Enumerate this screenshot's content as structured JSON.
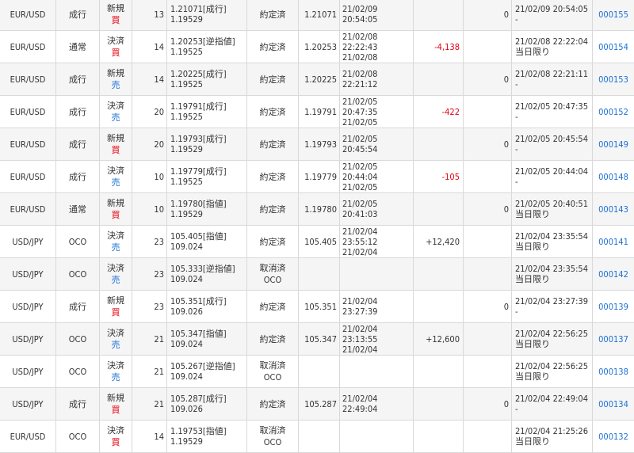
{
  "colors": {
    "buy": "#e60012",
    "sell": "#1a6fd6",
    "negative": "#e60012",
    "link": "#1a6fd6",
    "grid": "#d9d9d9"
  },
  "rows": [
    {
      "pair": "EUR/USD",
      "kind": "成行",
      "trade": "新規",
      "side": "買",
      "side_type": "buy",
      "qty": "13",
      "price1": "1.21071[成行]",
      "price2": "1.19529",
      "status1": "約定済",
      "status2": "",
      "exec": "1.21071",
      "date1": "21/02/09 20:54:05",
      "date2": "",
      "pl": "",
      "pl_type": "",
      "swap": "0",
      "odate1": "21/02/09 20:54:05",
      "odate2": "-",
      "id": "000155"
    },
    {
      "pair": "EUR/USD",
      "kind": "通常",
      "trade": "決済",
      "side": "買",
      "side_type": "buy",
      "qty": "14",
      "price1": "1.20253[逆指値]",
      "price2": "1.19525",
      "status1": "約定済",
      "status2": "",
      "exec": "1.20253",
      "date1": "21/02/08 22:22:43",
      "date2": "21/02/08",
      "pl": "-4,138",
      "pl_type": "neg",
      "swap": "",
      "odate1": "21/02/08 22:22:04",
      "odate2": "当日限り",
      "id": "000154"
    },
    {
      "pair": "EUR/USD",
      "kind": "成行",
      "trade": "新規",
      "side": "売",
      "side_type": "sell",
      "qty": "14",
      "price1": "1.20225[成行]",
      "price2": "1.19525",
      "status1": "約定済",
      "status2": "",
      "exec": "1.20225",
      "date1": "21/02/08 22:21:12",
      "date2": "",
      "pl": "",
      "pl_type": "",
      "swap": "0",
      "odate1": "21/02/08 22:21:11",
      "odate2": "-",
      "id": "000153"
    },
    {
      "pair": "EUR/USD",
      "kind": "成行",
      "trade": "決済",
      "side": "売",
      "side_type": "sell",
      "qty": "20",
      "price1": "1.19791[成行]",
      "price2": "1.19525",
      "status1": "約定済",
      "status2": "",
      "exec": "1.19791",
      "date1": "21/02/05 20:47:35",
      "date2": "21/02/05",
      "pl": "-422",
      "pl_type": "neg",
      "swap": "",
      "odate1": "21/02/05 20:47:35",
      "odate2": "-",
      "id": "000152"
    },
    {
      "pair": "EUR/USD",
      "kind": "成行",
      "trade": "新規",
      "side": "買",
      "side_type": "buy",
      "qty": "20",
      "price1": "1.19793[成行]",
      "price2": "1.19529",
      "status1": "約定済",
      "status2": "",
      "exec": "1.19793",
      "date1": "21/02/05 20:45:54",
      "date2": "",
      "pl": "",
      "pl_type": "",
      "swap": "0",
      "odate1": "21/02/05 20:45:54",
      "odate2": "-",
      "id": "000149"
    },
    {
      "pair": "EUR/USD",
      "kind": "成行",
      "trade": "決済",
      "side": "売",
      "side_type": "sell",
      "qty": "10",
      "price1": "1.19779[成行]",
      "price2": "1.19525",
      "status1": "約定済",
      "status2": "",
      "exec": "1.19779",
      "date1": "21/02/05 20:44:04",
      "date2": "21/02/05",
      "pl": "-105",
      "pl_type": "neg",
      "swap": "",
      "odate1": "21/02/05 20:44:04",
      "odate2": "-",
      "id": "000148"
    },
    {
      "pair": "EUR/USD",
      "kind": "通常",
      "trade": "新規",
      "side": "買",
      "side_type": "buy",
      "qty": "10",
      "price1": "1.19780[指値]",
      "price2": "1.19529",
      "status1": "約定済",
      "status2": "",
      "exec": "1.19780",
      "date1": "21/02/05 20:41:03",
      "date2": "",
      "pl": "",
      "pl_type": "",
      "swap": "0",
      "odate1": "21/02/05 20:40:51",
      "odate2": "当日限り",
      "id": "000143"
    },
    {
      "pair": "USD/JPY",
      "kind": "OCO",
      "trade": "決済",
      "side": "売",
      "side_type": "sell",
      "qty": "23",
      "price1": "105.405[指値]",
      "price2": "109.024",
      "status1": "約定済",
      "status2": "",
      "exec": "105.405",
      "date1": "21/02/04 23:55:12",
      "date2": "21/02/04",
      "pl": "+12,420",
      "pl_type": "pos",
      "swap": "",
      "odate1": "21/02/04 23:35:54",
      "odate2": "当日限り",
      "id": "000141"
    },
    {
      "pair": "USD/JPY",
      "kind": "OCO",
      "trade": "決済",
      "side": "売",
      "side_type": "sell",
      "qty": "23",
      "price1": "105.333[逆指値]",
      "price2": "109.024",
      "status1": "取消済",
      "status2": "OCO",
      "exec": "",
      "date1": "",
      "date2": "",
      "pl": "",
      "pl_type": "",
      "swap": "",
      "odate1": "21/02/04 23:35:54",
      "odate2": "当日限り",
      "id": "000142"
    },
    {
      "pair": "USD/JPY",
      "kind": "成行",
      "trade": "新規",
      "side": "買",
      "side_type": "buy",
      "qty": "23",
      "price1": "105.351[成行]",
      "price2": "109.026",
      "status1": "約定済",
      "status2": "",
      "exec": "105.351",
      "date1": "21/02/04 23:27:39",
      "date2": "",
      "pl": "",
      "pl_type": "",
      "swap": "0",
      "odate1": "21/02/04 23:27:39",
      "odate2": "-",
      "id": "000139"
    },
    {
      "pair": "USD/JPY",
      "kind": "OCO",
      "trade": "決済",
      "side": "売",
      "side_type": "sell",
      "qty": "21",
      "price1": "105.347[指値]",
      "price2": "109.024",
      "status1": "約定済",
      "status2": "",
      "exec": "105.347",
      "date1": "21/02/04 23:13:55",
      "date2": "21/02/04",
      "pl": "+12,600",
      "pl_type": "pos",
      "swap": "",
      "odate1": "21/02/04 22:56:25",
      "odate2": "当日限り",
      "id": "000137"
    },
    {
      "pair": "USD/JPY",
      "kind": "OCO",
      "trade": "決済",
      "side": "売",
      "side_type": "sell",
      "qty": "21",
      "price1": "105.267[逆指値]",
      "price2": "109.024",
      "status1": "取消済",
      "status2": "OCO",
      "exec": "",
      "date1": "",
      "date2": "",
      "pl": "",
      "pl_type": "",
      "swap": "",
      "odate1": "21/02/04 22:56:25",
      "odate2": "当日限り",
      "id": "000138"
    },
    {
      "pair": "USD/JPY",
      "kind": "成行",
      "trade": "新規",
      "side": "買",
      "side_type": "buy",
      "qty": "21",
      "price1": "105.287[成行]",
      "price2": "109.026",
      "status1": "約定済",
      "status2": "",
      "exec": "105.287",
      "date1": "21/02/04 22:49:04",
      "date2": "",
      "pl": "",
      "pl_type": "",
      "swap": "0",
      "odate1": "21/02/04 22:49:04",
      "odate2": "-",
      "id": "000134"
    },
    {
      "pair": "EUR/USD",
      "kind": "OCO",
      "trade": "決済",
      "side": "買",
      "side_type": "buy",
      "qty": "14",
      "price1": "1.19753[指値]",
      "price2": "1.19529",
      "status1": "取消済",
      "status2": "OCO",
      "exec": "",
      "date1": "",
      "date2": "",
      "pl": "",
      "pl_type": "",
      "swap": "",
      "odate1": "21/02/04 21:25:26",
      "odate2": "当日限り",
      "id": "000132"
    }
  ]
}
